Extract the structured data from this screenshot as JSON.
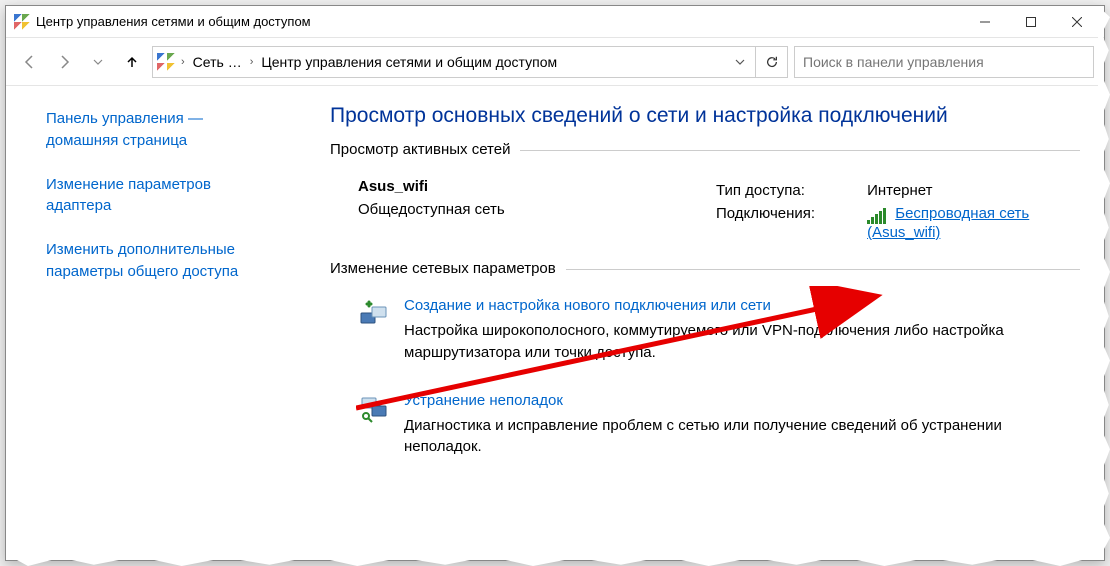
{
  "window": {
    "title": "Центр управления сетями и общим доступом"
  },
  "address": {
    "crumb1": "Сеть …",
    "crumb2": "Центр управления сетями и общим доступом"
  },
  "search": {
    "placeholder": "Поиск в панели управления"
  },
  "sidebar": {
    "home": "Панель управления — домашняя страница",
    "adapter": "Изменение параметров адаптера",
    "sharing": "Изменить дополнительные параметры общего доступа"
  },
  "content": {
    "heading": "Просмотр основных сведений о сети и настройка подключений",
    "group_active": "Просмотр активных сетей",
    "network": {
      "name": "Asus_wifi",
      "type": "Общедоступная сеть",
      "access_label": "Тип доступа:",
      "access_value": "Интернет",
      "conn_label": "Подключения:",
      "conn_value": "Беспроводная сеть (Asus_wifi)"
    },
    "group_change": "Изменение сетевых параметров",
    "action_new": {
      "title": "Создание и настройка нового подключения или сети",
      "desc": "Настройка широкополосного, коммутируемого или VPN-подключения либо настройка маршрутизатора или точки доступа."
    },
    "action_trouble": {
      "title": "Устранение неполадок",
      "desc": "Диагностика и исправление проблем с сетью или получение сведений об устранении неполадок."
    }
  }
}
